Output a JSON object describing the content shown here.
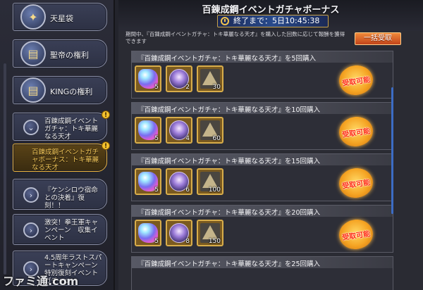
{
  "header": {
    "title": "百錬成鋼イベントガチャボーナス",
    "timer_text": "終了まで：5日10:45:38"
  },
  "description": "期間中、『百錬成鋼イベントガチャ：トキ華麗なる天才』を購入した回数に応じて報酬を獲得できます",
  "claim_all_label": "一括受取",
  "sidebar": {
    "items": [
      {
        "label": "天星袋",
        "icon": "bag-icon"
      },
      {
        "label": "聖帝の権利",
        "icon": "scroll-icon"
      },
      {
        "label": "KINGの権利",
        "icon": "scroll-icon"
      },
      {
        "label": "百錬成鋼イベントガチャ：トキ華麗なる天才",
        "icon": "chevron-icon",
        "alert": "!"
      },
      {
        "label": "百錬成鋼イベントガチャボーナス：トキ華麗なる天才",
        "alert": "!",
        "active": true
      },
      {
        "label": "『ケンシロウ宿命との決着』復刻！！",
        "icon": "chevron-icon"
      },
      {
        "label": "激突！拳王軍キャンペーン　収集イベント",
        "icon": "chevron-icon"
      },
      {
        "label": "4.5周年ラストスパートキャンペーン特別復刻イベントガチャp",
        "icon": "chevron-icon"
      }
    ]
  },
  "rewards": {
    "claim_label": "受取可能",
    "rows": [
      {
        "title": "『百錬成鋼イベントガチャ：トキ華麗なる天才』を5回購入",
        "items": [
          "5",
          "2",
          "30"
        ]
      },
      {
        "title": "『百錬成鋼イベントガチャ：トキ華麗なる天才』を10回購入",
        "items": [
          "5",
          "4",
          "60"
        ]
      },
      {
        "title": "『百錬成鋼イベントガチャ：トキ華麗なる天才』を15回購入",
        "items": [
          "5",
          "6",
          "100"
        ]
      },
      {
        "title": "『百錬成鋼イベントガチャ：トキ華麗なる天才』を20回購入",
        "items": [
          "5",
          "8",
          "150"
        ]
      },
      {
        "title": "『百錬成鋼イベントガチャ：トキ華麗なる天才』を25回購入",
        "items": []
      }
    ],
    "item_types": [
      "gem-icon",
      "orb-icon",
      "triangle-icon"
    ]
  },
  "watermark": "ファミ通.com",
  "colors": {
    "accent_gold": "#d8ad4a",
    "claim_orange": "#f5a423",
    "active_item_text": "#f6c95a",
    "timer_blue": "#284a8c"
  }
}
